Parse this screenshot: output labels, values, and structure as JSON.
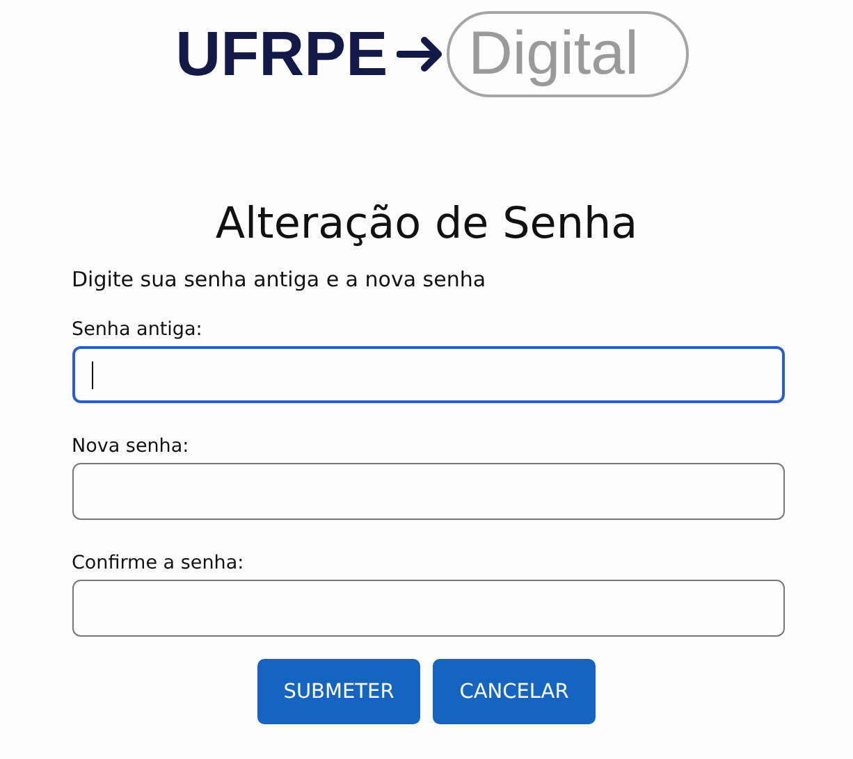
{
  "logo": {
    "primary": "UFRPE",
    "secondary": "Digital"
  },
  "title": "Alteração de Senha",
  "instructions": "Digite sua senha antiga e a nova senha",
  "fields": [
    {
      "label": "Senha antiga:",
      "focused": true
    },
    {
      "label": "Nova senha:",
      "focused": false
    },
    {
      "label": "Confirme a senha:",
      "focused": false
    }
  ],
  "buttons": [
    "SUBMETER",
    "CANCELAR"
  ]
}
